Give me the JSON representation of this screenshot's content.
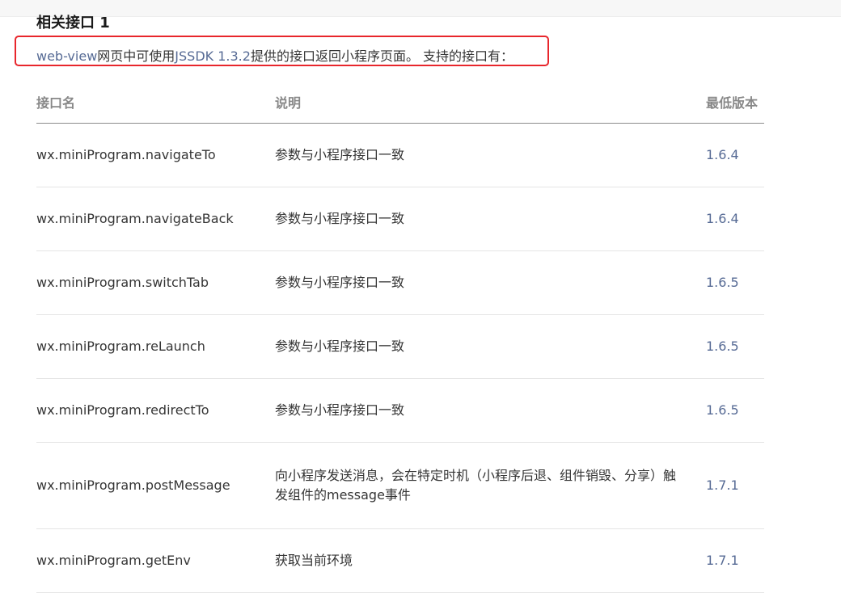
{
  "section": {
    "title": "相关接口 1"
  },
  "intro": {
    "link_text": "web-view",
    "text_1": "网页中可使用",
    "sdk_text": "JSSDK 1.3.2",
    "text_2": "提供的接口返回小程序页面。 支持的接口有："
  },
  "table": {
    "headers": {
      "name": "接口名",
      "desc": "说明",
      "version": "最低版本"
    },
    "rows": [
      {
        "name": "wx.miniProgram.navigateTo",
        "desc": "参数与小程序接口一致",
        "version": "1.6.4"
      },
      {
        "name": "wx.miniProgram.navigateBack",
        "desc": "参数与小程序接口一致",
        "version": "1.6.4"
      },
      {
        "name": "wx.miniProgram.switchTab",
        "desc": "参数与小程序接口一致",
        "version": "1.6.5"
      },
      {
        "name": "wx.miniProgram.reLaunch",
        "desc": "参数与小程序接口一致",
        "version": "1.6.5"
      },
      {
        "name": "wx.miniProgram.redirectTo",
        "desc": "参数与小程序接口一致",
        "version": "1.6.5"
      },
      {
        "name": "wx.miniProgram.postMessage",
        "desc": "向小程序发送消息，会在特定时机（小程序后退、组件销毁、分享）触发组件的message事件",
        "version": "1.7.1"
      },
      {
        "name": "wx.miniProgram.getEnv",
        "desc": "获取当前环境",
        "version": "1.7.1"
      }
    ]
  },
  "colors": {
    "link": "#576b95",
    "highlight_border": "#e8262c"
  }
}
